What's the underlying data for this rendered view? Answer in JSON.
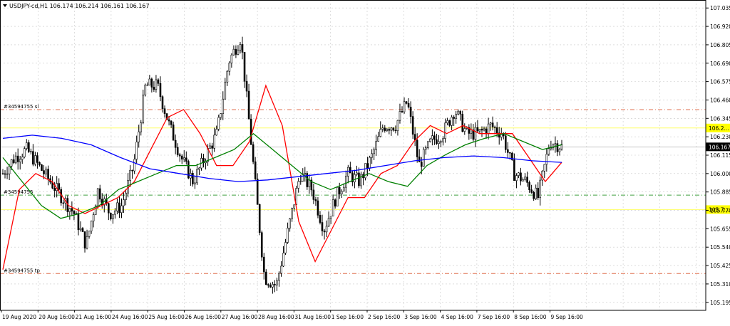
{
  "header": {
    "symbol_label": "USDJPY-cd,H1  106.174 106.214 106.161 106.167"
  },
  "colors": {
    "background": "#ffffff",
    "grid": "#c8c8c8",
    "candle": "#000000",
    "ma_fast": "#ff0000",
    "ma_mid": "#008000",
    "ma_slow": "#0000ff",
    "level_yellow": "#ffff66",
    "order_sl_tp": "#e07050",
    "order_entry": "#40a040",
    "price_tag_bg": "#000000",
    "yellow_tag_bg": "#ffff00"
  },
  "chart_data": {
    "type": "candlestick",
    "symbol": "USDJPY-cd",
    "timeframe": "H1",
    "ohlc_header": {
      "open": 106.174,
      "high": 106.214,
      "low": 106.161,
      "close": 106.167
    },
    "last_price": "106.167",
    "ylim": [
      105.145,
      107.085
    ],
    "y_ticks": [
      "107.035",
      "106.920",
      "106.805",
      "106.690",
      "106.575",
      "106.460",
      "106.345",
      "106.230",
      "106.115",
      "106.000",
      "105.885",
      "105.770",
      "105.655",
      "105.540",
      "105.425",
      "105.310",
      "105.195"
    ],
    "x_ticks": [
      "19 Aug 2020",
      "20 Aug 16:00",
      "21 Aug 16:00",
      "24 Aug 16:00",
      "25 Aug 16:00",
      "26 Aug 16:00",
      "27 Aug 16:00",
      "28 Aug 16:00",
      "31 Aug 16:00",
      "1 Sep 16:00",
      "2 Sep 16:00",
      "3 Sep 16:00",
      "4 Sep 16:00",
      "7 Sep 16:00",
      "8 Sep 16:00",
      "9 Sep 16:00"
    ],
    "grid": true,
    "horizontal_levels": [
      {
        "label": "#34594755 sl",
        "price": 106.4,
        "kind": "order_sl_tp",
        "style": "dash-dot"
      },
      {
        "label": "",
        "price": 106.285,
        "kind": "level_yellow",
        "style": "solid",
        "tag": "106.2..."
      },
      {
        "label": "#34594755",
        "price": 105.865,
        "kind": "order_entry",
        "style": "dash-dot"
      },
      {
        "label": "",
        "price": 105.775,
        "kind": "level_yellow",
        "style": "solid",
        "tag": "105.7..."
      },
      {
        "label": "#34594755 tp",
        "price": 105.375,
        "kind": "order_sl_tp",
        "style": "dash-dot"
      }
    ],
    "price_anchors": [
      106.0,
      106.1,
      106.15,
      106.05,
      105.95,
      105.85,
      105.75,
      105.55,
      105.9,
      105.75,
      105.8,
      106.05,
      106.55,
      106.55,
      106.3,
      106.1,
      105.95,
      106.1,
      106.25,
      106.7,
      106.85,
      106.1,
      105.35,
      105.3,
      105.65,
      106.0,
      105.9,
      105.65,
      105.85,
      106.0,
      105.95,
      106.1,
      106.3,
      106.3,
      106.45,
      106.05,
      106.2,
      106.25,
      106.4,
      106.25,
      106.25,
      106.3,
      106.25,
      106.0,
      105.95,
      105.85,
      106.2,
      106.17
    ],
    "series": [
      {
        "name": "MA fast",
        "color_key": "ma_fast",
        "values": [
          105.4,
          105.9,
          106.0,
          105.95,
          105.8,
          105.75,
          105.8,
          105.85,
          105.95,
          106.15,
          106.35,
          106.4,
          106.25,
          106.05,
          106.05,
          106.2,
          106.55,
          106.3,
          105.7,
          105.45,
          105.65,
          105.85,
          105.85,
          106.0,
          106.05,
          106.2,
          106.3,
          106.25,
          106.3,
          106.25,
          106.25,
          106.25,
          106.1,
          105.95,
          106.07
        ]
      },
      {
        "name": "MA mid",
        "color_key": "ma_mid",
        "values": [
          106.1,
          105.95,
          105.8,
          105.72,
          105.75,
          105.8,
          105.9,
          105.95,
          106.0,
          106.05,
          106.05,
          106.1,
          106.15,
          106.25,
          106.15,
          106.05,
          105.95,
          105.9,
          105.95,
          106.0,
          105.95,
          105.92,
          106.05,
          106.12,
          106.18,
          106.22,
          106.25,
          106.2,
          106.15,
          106.18
        ]
      },
      {
        "name": "MA slow",
        "color_key": "ma_slow",
        "values": [
          106.22,
          106.24,
          106.22,
          106.18,
          106.1,
          106.03,
          106.0,
          105.97,
          105.95,
          105.96,
          105.98,
          106.0,
          106.02,
          106.05,
          106.08,
          106.1,
          106.11,
          106.1,
          106.08,
          106.07
        ]
      }
    ]
  }
}
